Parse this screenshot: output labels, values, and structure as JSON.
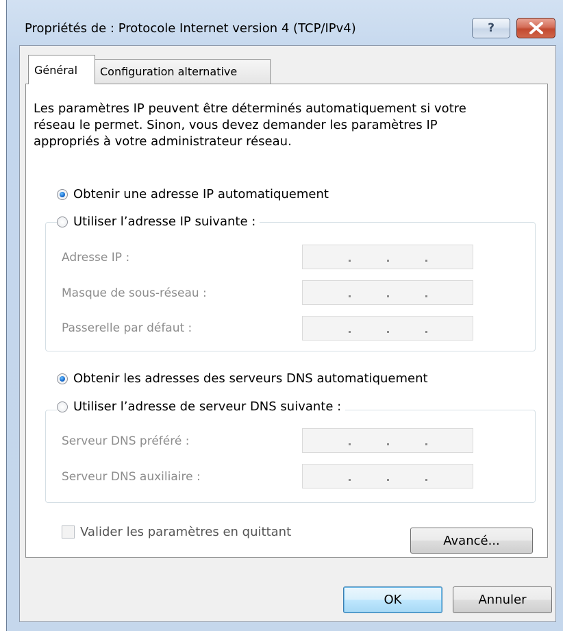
{
  "window": {
    "title": "Propriétés de : Protocole Internet version 4 (TCP/IPv4)",
    "help_label": "?"
  },
  "tabs": [
    {
      "label": "Général",
      "active": true
    },
    {
      "label": "Configuration alternative",
      "active": false
    }
  ],
  "description": [
    "Les paramètres IP peuvent être déterminés automatiquement si votre",
    "réseau le permet. Sinon, vous devez demander les paramètres IP",
    "appropriés à votre administrateur réseau."
  ],
  "ip_section": {
    "auto_label": "Obtenir une adresse IP automatiquement",
    "auto_selected": true,
    "manual_label": "Utiliser l’adresse IP suivante :",
    "fields": [
      {
        "label": "Adresse IP :",
        "value": ""
      },
      {
        "label": "Masque de sous-réseau :",
        "value": ""
      },
      {
        "label": "Passerelle par défaut :",
        "value": ""
      }
    ]
  },
  "dns_section": {
    "auto_label": "Obtenir les adresses des serveurs DNS automatiquement",
    "auto_selected": true,
    "manual_label": "Utiliser l’adresse de serveur DNS suivante :",
    "fields": [
      {
        "label": "Serveur DNS préféré :",
        "value": ""
      },
      {
        "label": "Serveur DNS auxiliaire :",
        "value": ""
      }
    ]
  },
  "validate_checkbox": {
    "label": "Valider les paramètres en quittant",
    "checked": false
  },
  "buttons": {
    "advanced": "Avancé...",
    "ok": "OK",
    "cancel": "Annuler"
  },
  "colors": {
    "accent": "#3c7fb1",
    "close": "#c24a30",
    "disabled_text": "#8d8d8d"
  }
}
